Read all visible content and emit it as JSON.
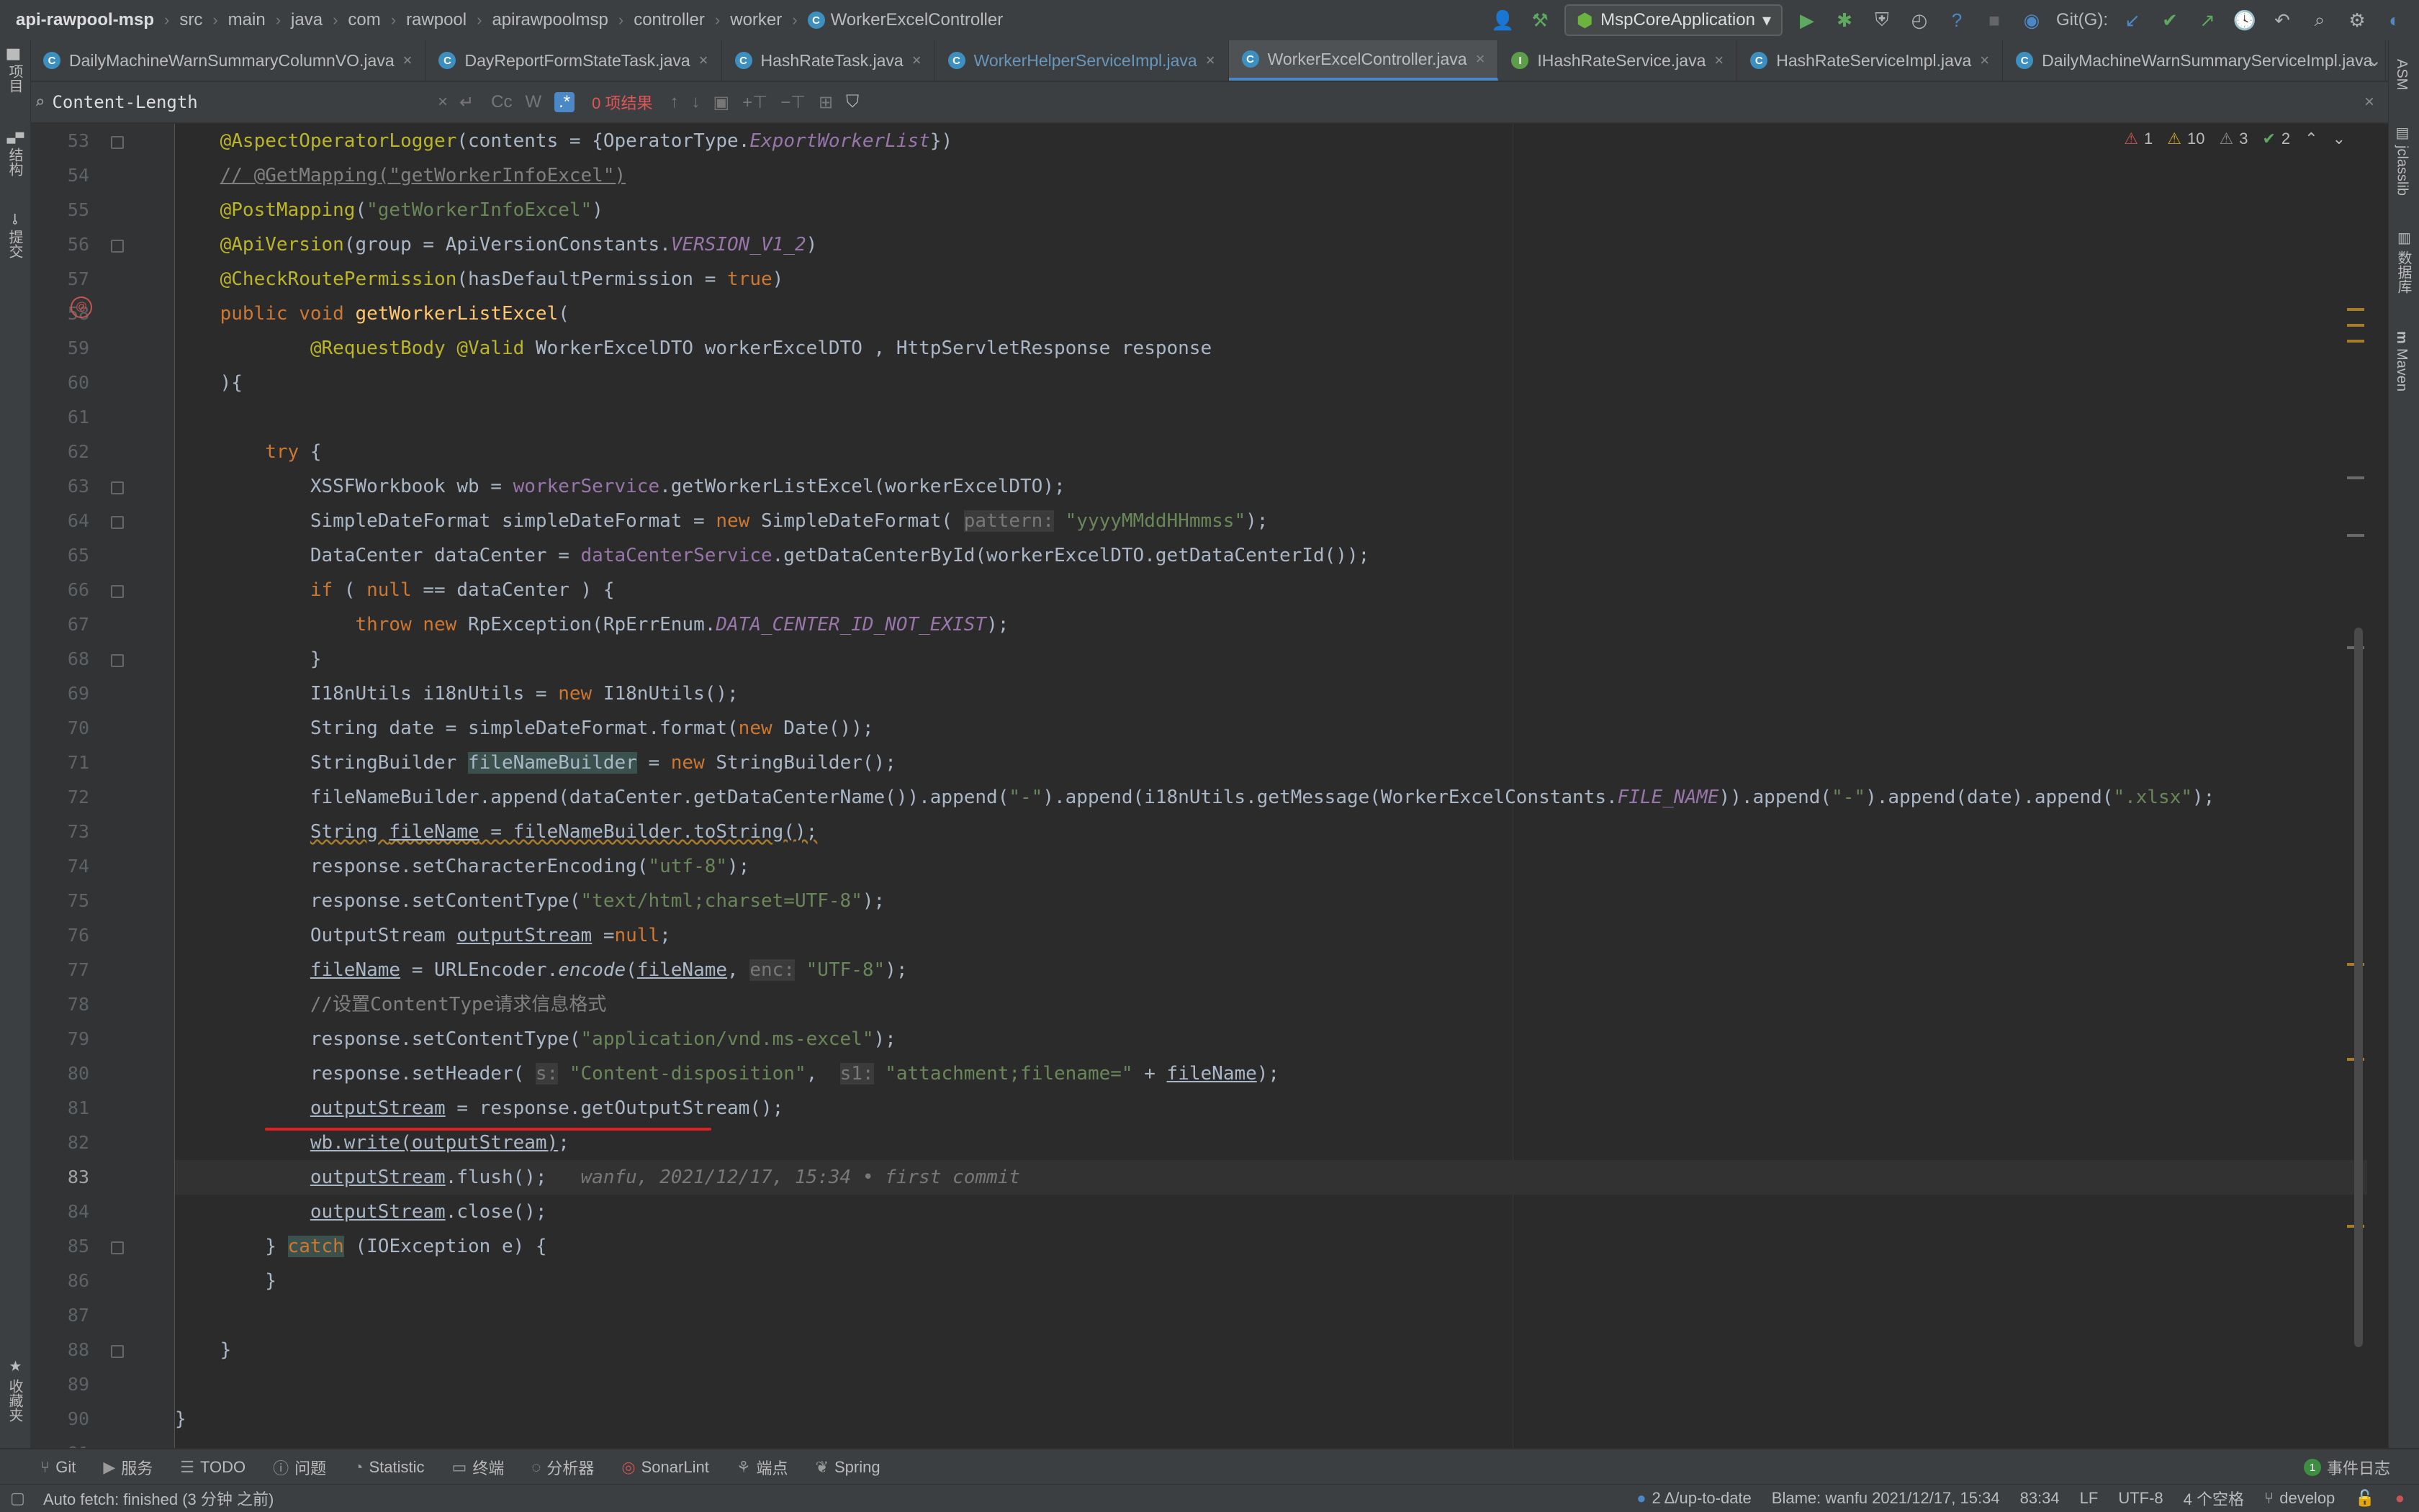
{
  "nav": {
    "project": "api-rawpool-msp",
    "breadcrumbs": [
      "src",
      "main",
      "java",
      "com",
      "rawpool",
      "apirawpoolmsp",
      "controller",
      "worker",
      "WorkerExcelController"
    ],
    "run_config": "MspCoreApplication",
    "git_label": "Git(G):"
  },
  "tabs": [
    {
      "label": "DailyMachineWarnSummaryColumnVO.java",
      "badge": "C"
    },
    {
      "label": "DayReportFormStateTask.java",
      "badge": "C"
    },
    {
      "label": "HashRateTask.java",
      "badge": "C"
    },
    {
      "label": "WorkerHelperServiceImpl.java",
      "badge": "C"
    },
    {
      "label": "WorkerExcelController.java",
      "badge": "C"
    },
    {
      "label": "IHashRateService.java",
      "badge": "I"
    },
    {
      "label": "HashRateServiceImpl.java",
      "badge": "C"
    },
    {
      "label": "DailyMachineWarnSummaryServiceImpl.java",
      "badge": "C"
    }
  ],
  "find": {
    "query": "Content-Length",
    "results": "0 项结果",
    "opt_case": "Cc",
    "opt_word": "W",
    "opt_regex": ".*"
  },
  "left_tools": [
    "项目",
    "结构",
    "提交",
    "收藏夹"
  ],
  "right_tools": [
    "ASM",
    "jclasslib",
    "数据库",
    "Maven"
  ],
  "inspections": {
    "errors": "1",
    "warnings": "10",
    "weak": "3",
    "ok": "2"
  },
  "colors": {
    "keyword": "#cc7832",
    "string": "#6a8759",
    "annotation": "#bbb529",
    "field": "#9876aa",
    "method": "#ffc66d",
    "comment": "#808080",
    "hint": "#787878",
    "accent": "#4a88c7"
  },
  "code": {
    "current_line": "83",
    "lines": [
      {
        "n": "53",
        "html": "    <span style=\"color:#bbb529\">@AspectOperatorLogger</span>(contents = {OperatorType.<span style=\"color:#9876aa;font-style:italic\">ExportWorkerList</span>})"
      },
      {
        "n": "54",
        "html": "    <span style=\"color:#808080;text-decoration:underline\">// @GetMapping(\"getWorkerInfoExcel\")</span>"
      },
      {
        "n": "55",
        "html": "    <span style=\"color:#bbb529\">@PostMapping</span>(<span style=\"color:#6a8759\">\"getWorkerInfoExcel\"</span>)"
      },
      {
        "n": "56",
        "html": "    <span style=\"color:#bbb529\">@ApiVersion</span>(group = ApiVersionConstants.<span style=\"color:#9876aa;font-style:italic\">VERSION_V1_2</span>)"
      },
      {
        "n": "57",
        "html": "    <span style=\"color:#bbb529\">@CheckRoutePermission</span>(hasDefaultPermission = <span style=\"color:#cc7832\">true</span>)"
      },
      {
        "n": "58",
        "html": "    <span style=\"color:#cc7832\">public void</span> <span style=\"color:#ffc66d\">getWorkerListExcel</span>("
      },
      {
        "n": "59",
        "html": "            <span style=\"color:#bbb529\">@RequestBody</span> <span style=\"color:#bbb529\">@Valid</span> WorkerExcelDTO workerExcelDTO , HttpServletResponse response"
      },
      {
        "n": "60",
        "html": "    ){"
      },
      {
        "n": "61",
        "html": ""
      },
      {
        "n": "62",
        "html": "        <span style=\"color:#cc7832\">try</span> {"
      },
      {
        "n": "63",
        "html": "            XSSFWorkbook wb = <span style=\"color:#9876aa\">workerService</span>.getWorkerListExcel(workerExcelDTO);"
      },
      {
        "n": "64",
        "html": "            SimpleDateFormat simpleDateFormat = <span style=\"color:#cc7832\">new</span> SimpleDateFormat( <span style=\"color:#787878;background:#3b3b3b\">pattern:</span> <span style=\"color:#6a8759\">\"yyyyMMddHHmmss\"</span>);"
      },
      {
        "n": "65",
        "html": "            DataCenter dataCenter = <span style=\"color:#9876aa\">dataCenterService</span>.getDataCenterById(workerExcelDTO.getDataCenterId());"
      },
      {
        "n": "66",
        "html": "            <span style=\"color:#cc7832\">if</span> ( <span style=\"color:#cc7832\">null</span> == dataCenter ) {"
      },
      {
        "n": "67",
        "html": "                <span style=\"color:#cc7832\">throw new</span> RpException(RpErrEnum.<span style=\"color:#9876aa;font-style:italic\">DATA_CENTER_ID_NOT_EXIST</span>);"
      },
      {
        "n": "68",
        "html": "            }"
      },
      {
        "n": "69",
        "html": "            I18nUtils i18nUtils = <span style=\"color:#cc7832\">new</span> I18nUtils();"
      },
      {
        "n": "70",
        "html": "            String date = simpleDateFormat.format(<span style=\"color:#cc7832\">new</span> Date());"
      },
      {
        "n": "71",
        "html": "            StringBuilder <span style=\"background:#3b514d\">fileNameBuilder</span> = <span style=\"color:#cc7832\">new</span> StringBuilder();"
      },
      {
        "n": "72",
        "html": "            fileNameBuilder.append(dataCenter.getDataCenterName()).append(<span style=\"color:#6a8759\">\"-\"</span>).append(i18nUtils.getMessage(WorkerExcelConstants.<span style=\"color:#9876aa;font-style:italic\">FILE_NAME</span>)).append(<span style=\"color:#6a8759\">\"-\"</span>).append(date).append(<span style=\"color:#6a8759\">\".xlsx\"</span>);"
      },
      {
        "n": "73",
        "html": "            <span style=\"text-decoration:underline wavy #a77b2a\">String <u>fileName</u> = fileNameBuilder.toString();</span>"
      },
      {
        "n": "74",
        "html": "            response.setCharacterEncoding(<span style=\"color:#6a8759\">\"utf-8\"</span>);"
      },
      {
        "n": "75",
        "html": "            response.setContentType(<span style=\"color:#6a8759\">\"text/html;charset=UTF-8\"</span>);"
      },
      {
        "n": "76",
        "html": "            OutputStream <u>outputStream</u> =<span style=\"color:#cc7832\">null</span>;"
      },
      {
        "n": "77",
        "html": "            <u>fileName</u> = URLEncoder.<i>encode</i>(<u>fileName</u>, <span style=\"color:#787878;background:#3b3b3b\">enc:</span> <span style=\"color:#6a8759\">\"UTF-8\"</span>);"
      },
      {
        "n": "78",
        "html": "            <span style=\"color:#808080\">//设置ContentType请求信息格式</span>"
      },
      {
        "n": "79",
        "html": "            response.setContentType(<span style=\"color:#6a8759\">\"application/vnd.ms-excel\"</span>);"
      },
      {
        "n": "80",
        "html": "            response.setHeader( <span style=\"color:#787878;background:#3b3b3b\">s:</span> <span style=\"color:#6a8759\">\"Content-disposition\"</span>,  <span style=\"color:#787878;background:#3b3b3b\">s1:</span> <span style=\"color:#6a8759\">\"attachment;filename=\"</span> + <u>fileName</u>);"
      },
      {
        "n": "81",
        "html": "            <u>outputStream</u> = response.getOutputStream();"
      },
      {
        "n": "82",
        "html": "            <u>wb.write(outputStream)</u>;"
      },
      {
        "n": "83",
        "html": "            <u>outputStream</u>.flush();   <span style=\"color:#787878;font-style:italic\">wanfu, 2021/12/17, 15:34 • first commit</span>"
      },
      {
        "n": "84",
        "html": "            <u>outputStream</u>.close();"
      },
      {
        "n": "85",
        "html": "        } <span style=\"color:#cc7832;background:#3b514d\">catch</span> (IOException e) {"
      },
      {
        "n": "86",
        "html": "        }"
      },
      {
        "n": "87",
        "html": ""
      },
      {
        "n": "88",
        "html": "    }"
      },
      {
        "n": "89",
        "html": ""
      },
      {
        "n": "90",
        "html": "}"
      },
      {
        "n": "91",
        "html": ""
      }
    ]
  },
  "toolwindows": [
    "Git",
    "服务",
    "TODO",
    "问题",
    "Statistic",
    "终端",
    "分析器",
    "SonarLint",
    "端点",
    "Spring"
  ],
  "event_log": {
    "count": "1",
    "label": "事件日志"
  },
  "status": {
    "message": "Auto fetch: finished (3 分钟 之前)",
    "vcs": "2 Δ/up-to-date",
    "blame": "Blame: wanfu 2021/12/17, 15:34",
    "position": "83:34",
    "line_sep": "LF",
    "encoding": "UTF-8",
    "indent": "4 个空格",
    "branch": "develop"
  }
}
